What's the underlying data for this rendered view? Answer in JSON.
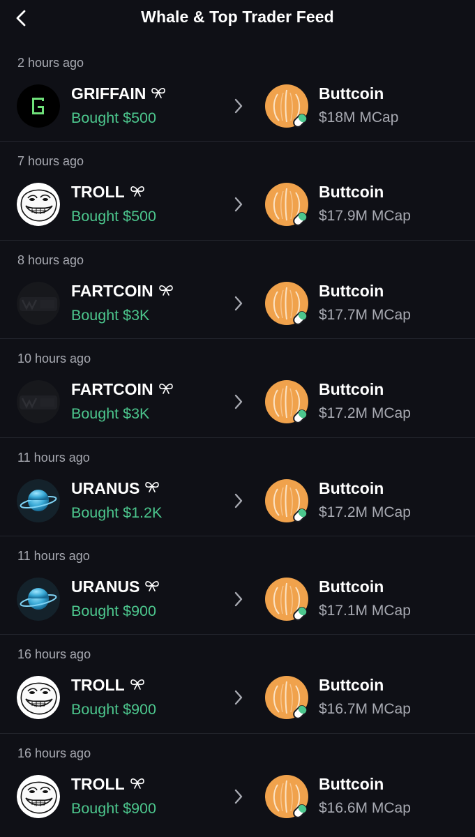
{
  "header": {
    "title": "Whale & Top Trader Feed",
    "back_icon": "chevron-left-icon"
  },
  "colors": {
    "background": "#0f1016",
    "bought_green": "#4cc68d",
    "secondary_text": "#a8aab2",
    "token_orange": "#f0a24c",
    "divider": "#23252d"
  },
  "feed": [
    {
      "time": "2 hours ago",
      "trader": "GRIFFAIN",
      "avatar": "griffain",
      "action": "Bought $500",
      "token": "Buttcoin",
      "mcap": "$18M MCap"
    },
    {
      "time": "7 hours ago",
      "trader": "TROLL",
      "avatar": "troll",
      "action": "Bought $500",
      "token": "Buttcoin",
      "mcap": "$17.9M MCap"
    },
    {
      "time": "8 hours ago",
      "trader": "FARTCOIN",
      "avatar": "fartcoin",
      "action": "Bought $3K",
      "token": "Buttcoin",
      "mcap": "$17.7M MCap"
    },
    {
      "time": "10 hours ago",
      "trader": "FARTCOIN",
      "avatar": "fartcoin",
      "action": "Bought $3K",
      "token": "Buttcoin",
      "mcap": "$17.2M MCap"
    },
    {
      "time": "11 hours ago",
      "trader": "URANUS",
      "avatar": "uranus",
      "action": "Bought $1.2K",
      "token": "Buttcoin",
      "mcap": "$17.2M MCap"
    },
    {
      "time": "11 hours ago",
      "trader": "URANUS",
      "avatar": "uranus",
      "action": "Bought $900",
      "token": "Buttcoin",
      "mcap": "$17.1M MCap"
    },
    {
      "time": "16 hours ago",
      "trader": "TROLL",
      "avatar": "troll",
      "action": "Bought $900",
      "token": "Buttcoin",
      "mcap": "$16.7M MCap"
    },
    {
      "time": "16 hours ago",
      "trader": "TROLL",
      "avatar": "troll",
      "action": "Bought $900",
      "token": "Buttcoin",
      "mcap": "$16.6M MCap"
    }
  ]
}
